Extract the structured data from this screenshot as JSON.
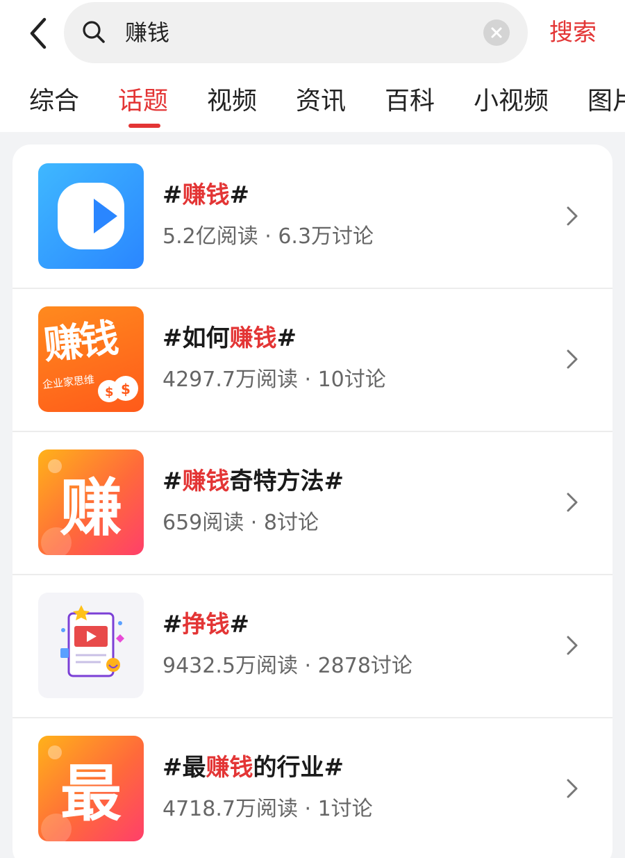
{
  "search": {
    "query": "赚钱",
    "action_label": "搜索"
  },
  "tabs": [
    {
      "label": "综合"
    },
    {
      "label": "话题"
    },
    {
      "label": "视频"
    },
    {
      "label": "资讯"
    },
    {
      "label": "百科"
    },
    {
      "label": "小视频"
    },
    {
      "label": "图片"
    }
  ],
  "active_tab": "话题",
  "accent_color": "#e33535",
  "topics": [
    {
      "title_prefix": "#",
      "title_highlight": "赚钱",
      "title_suffix": "#",
      "stats": "5.2亿阅读 · 6.3万讨论",
      "thumb": {
        "icon": "play-icon",
        "text": "",
        "subtext": ""
      }
    },
    {
      "title_prefix": "#如何",
      "title_highlight": "赚钱",
      "title_suffix": "#",
      "stats": "4297.7万阅读 · 10讨论",
      "thumb": {
        "icon": "money-bag-icon",
        "text": "赚钱",
        "subtext": "企业家思维"
      }
    },
    {
      "title_prefix": "#",
      "title_highlight": "赚钱",
      "title_suffix": "奇特方法#",
      "stats": "659阅读 · 8讨论",
      "thumb": {
        "icon": "",
        "text": "赚",
        "subtext": ""
      }
    },
    {
      "title_prefix": "#",
      "title_highlight": "挣钱",
      "title_suffix": "#",
      "stats": "9432.5万阅读 · 2878讨论",
      "thumb": {
        "icon": "video-document-icon",
        "text": "",
        "subtext": ""
      }
    },
    {
      "title_prefix": "#最",
      "title_highlight": "赚钱",
      "title_suffix": "的行业#",
      "stats": "4718.7万阅读 · 1讨论",
      "thumb": {
        "icon": "",
        "text": "最",
        "subtext": ""
      }
    }
  ]
}
